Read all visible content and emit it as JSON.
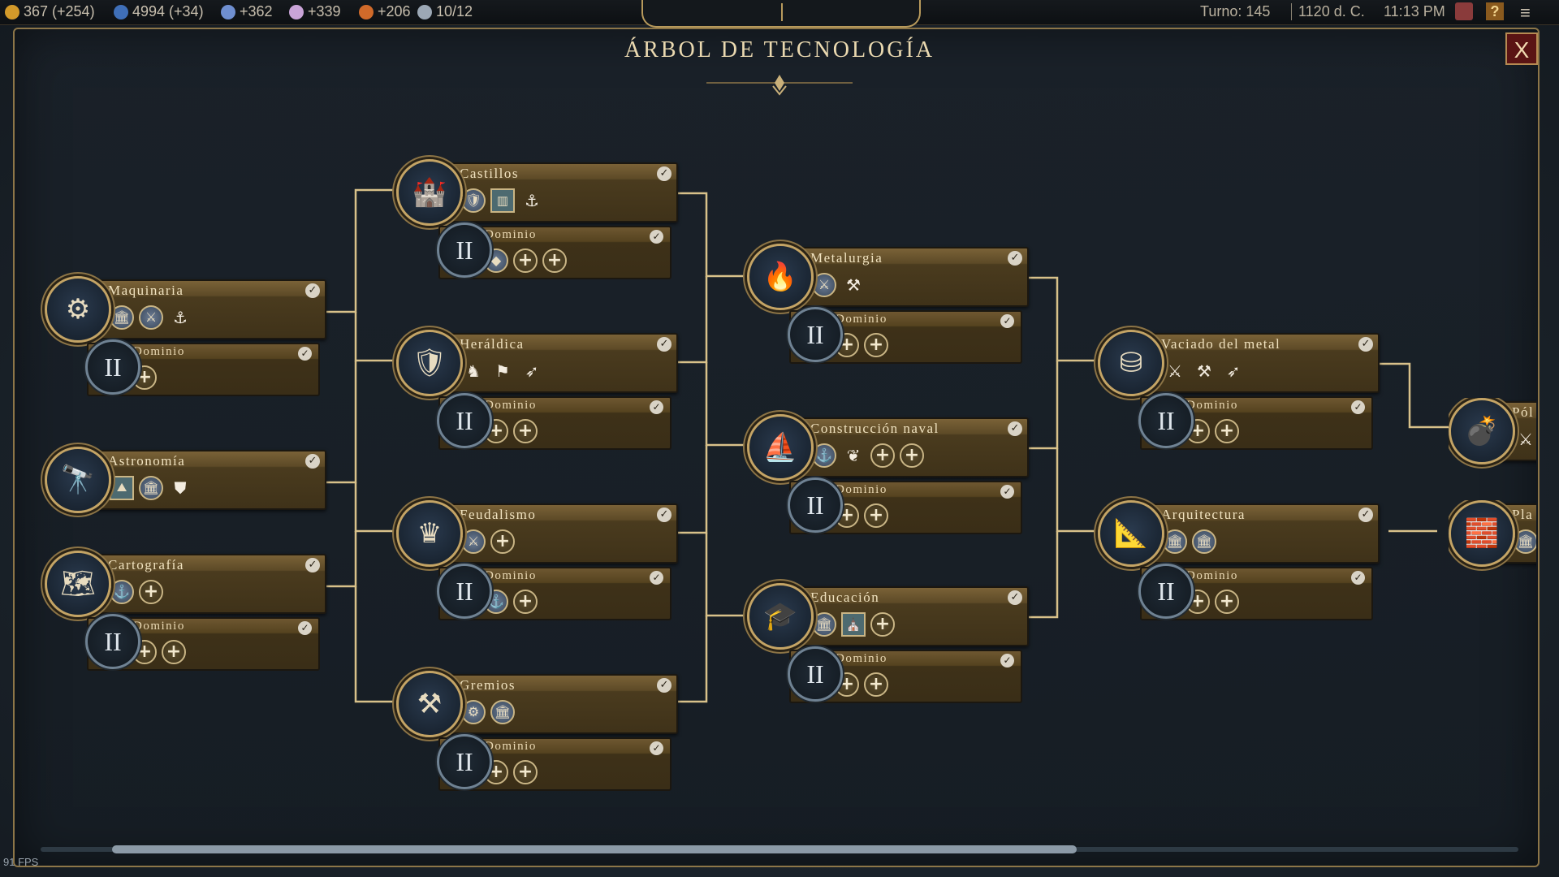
{
  "topbar": {
    "resources": [
      {
        "icon": "gold-icon",
        "text": "367 (+254)",
        "color": "#d39a2a"
      },
      {
        "icon": "globe-icon",
        "text": "4994 (+34)",
        "color": "#3f6fb8"
      },
      {
        "icon": "faith-icon",
        "text": "+362",
        "color": "#6f8fd0"
      },
      {
        "icon": "music-icon",
        "text": "+339",
        "color": "#c9a4d8"
      },
      {
        "icon": "happiness-icon",
        "text": "+206",
        "color": "#d06a2a"
      },
      {
        "icon": "trade-icon",
        "text": "10/12",
        "color": "#9ca8b5"
      }
    ],
    "turn": "Turno: 145",
    "year": "1120 d. C.",
    "time": "11:13 PM"
  },
  "title": "ÁRBOL DE TECNOLOGÍA",
  "close_label": "X",
  "fps": "91 FPS",
  "techs": [
    {
      "id": "maquinaria",
      "name": "Maquinaria",
      "icon": "gear-icon",
      "glyph": "⚙",
      "unlocks": [
        {
          "t": "round",
          "g": "🏛"
        },
        {
          "t": "round",
          "g": "⚔"
        },
        {
          "t": "glyph",
          "g": "⚓"
        }
      ],
      "sub": {
        "name": "Dominio",
        "unlocks": [
          {
            "t": "plus",
            "g": "+"
          }
        ]
      }
    },
    {
      "id": "astronomia",
      "name": "Astronomía",
      "icon": "telescope-icon",
      "glyph": "🔭",
      "unlocks": [
        {
          "t": "square",
          "g": "⛰"
        },
        {
          "t": "round",
          "g": "🏛"
        },
        {
          "t": "glyph",
          "g": "⛊"
        }
      ],
      "sub": null
    },
    {
      "id": "cartografia",
      "name": "Cartografía",
      "icon": "map-icon",
      "glyph": "🗺",
      "unlocks": [
        {
          "t": "round",
          "g": "⚓"
        },
        {
          "t": "plus",
          "g": "+"
        }
      ],
      "sub": {
        "name": "Dominio",
        "unlocks": [
          {
            "t": "plus",
            "g": "+"
          },
          {
            "t": "plus",
            "g": "+"
          }
        ]
      }
    },
    {
      "id": "castillos",
      "name": "Castillos",
      "icon": "castle-icon",
      "glyph": "🏰",
      "unlocks": [
        {
          "t": "round",
          "g": "🛡"
        },
        {
          "t": "square",
          "g": "▥"
        },
        {
          "t": "glyph",
          "g": "⚓"
        }
      ],
      "sub": {
        "name": "Dominio",
        "unlocks": [
          {
            "t": "round",
            "g": "◆"
          },
          {
            "t": "plus",
            "g": "+"
          },
          {
            "t": "plus",
            "g": "+"
          }
        ]
      }
    },
    {
      "id": "heraldica",
      "name": "Heráldica",
      "icon": "shield-icon",
      "glyph": "🛡",
      "unlocks": [
        {
          "t": "glyph",
          "g": "♞"
        },
        {
          "t": "glyph",
          "g": "⚑"
        },
        {
          "t": "glyph",
          "g": "➶"
        }
      ],
      "sub": {
        "name": "Dominio",
        "unlocks": [
          {
            "t": "plus",
            "g": "+"
          },
          {
            "t": "plus",
            "g": "+"
          }
        ]
      }
    },
    {
      "id": "feudalismo",
      "name": "Feudalismo",
      "icon": "crown-icon",
      "glyph": "♛",
      "unlocks": [
        {
          "t": "round",
          "g": "⚔"
        },
        {
          "t": "plus",
          "g": "+"
        }
      ],
      "sub": {
        "name": "Dominio",
        "unlocks": [
          {
            "t": "round",
            "g": "⚓"
          },
          {
            "t": "plus",
            "g": "+"
          }
        ]
      }
    },
    {
      "id": "gremios",
      "name": "Gremios",
      "icon": "hammers-icon",
      "glyph": "⚒",
      "unlocks": [
        {
          "t": "round",
          "g": "⚙"
        },
        {
          "t": "round",
          "g": "🏛"
        }
      ],
      "sub": {
        "name": "Dominio",
        "unlocks": [
          {
            "t": "plus",
            "g": "+"
          },
          {
            "t": "plus",
            "g": "+"
          }
        ]
      }
    },
    {
      "id": "metalurgia",
      "name": "Metalurgia",
      "icon": "forge-icon",
      "glyph": "🔥",
      "unlocks": [
        {
          "t": "round",
          "g": "⚔"
        },
        {
          "t": "glyph",
          "g": "⚒"
        }
      ],
      "sub": {
        "name": "Dominio",
        "unlocks": [
          {
            "t": "plus",
            "g": "+"
          },
          {
            "t": "plus",
            "g": "+"
          }
        ]
      }
    },
    {
      "id": "construccion",
      "name": "Construcción naval",
      "icon": "ship-icon",
      "glyph": "⛵",
      "unlocks": [
        {
          "t": "round",
          "g": "⚓"
        },
        {
          "t": "glyph",
          "g": "❦"
        },
        {
          "t": "plus",
          "g": "+"
        },
        {
          "t": "plus",
          "g": "+"
        }
      ],
      "sub": {
        "name": "Dominio",
        "unlocks": [
          {
            "t": "plus",
            "g": "+"
          },
          {
            "t": "plus",
            "g": "+"
          }
        ]
      }
    },
    {
      "id": "educacion",
      "name": "Educación",
      "icon": "scholar-cap-icon",
      "glyph": "🎓",
      "unlocks": [
        {
          "t": "round",
          "g": "🏛"
        },
        {
          "t": "square",
          "g": "⛪"
        },
        {
          "t": "plus",
          "g": "+"
        }
      ],
      "sub": {
        "name": "Dominio",
        "unlocks": [
          {
            "t": "plus",
            "g": "+"
          },
          {
            "t": "plus",
            "g": "+"
          }
        ]
      }
    },
    {
      "id": "vaciado",
      "name": "Vaciado del metal",
      "icon": "ingots-icon",
      "glyph": "⛁",
      "unlocks": [
        {
          "t": "glyph",
          "g": "⚔"
        },
        {
          "t": "glyph",
          "g": "⚒"
        },
        {
          "t": "glyph",
          "g": "➶"
        }
      ],
      "sub": {
        "name": "Dominio",
        "unlocks": [
          {
            "t": "plus",
            "g": "+"
          },
          {
            "t": "plus",
            "g": "+"
          }
        ]
      }
    },
    {
      "id": "arquitectura",
      "name": "Arquitectura",
      "icon": "compass-icon",
      "glyph": "📐",
      "unlocks": [
        {
          "t": "round",
          "g": "🏛"
        },
        {
          "t": "round",
          "g": "🏛"
        }
      ],
      "sub": {
        "name": "Dominio",
        "unlocks": [
          {
            "t": "plus",
            "g": "+"
          },
          {
            "t": "plus",
            "g": "+"
          }
        ]
      }
    },
    {
      "id": "polvora",
      "name": "Pól",
      "icon": "cannon-icon",
      "glyph": "💣",
      "unlocks": [
        {
          "t": "glyph",
          "g": "⚔"
        }
      ],
      "sub": null
    },
    {
      "id": "planeacion",
      "name": "Pla",
      "icon": "bricks-icon",
      "glyph": "🧱",
      "unlocks": [
        {
          "t": "round",
          "g": "🏛"
        }
      ],
      "sub": null
    }
  ]
}
